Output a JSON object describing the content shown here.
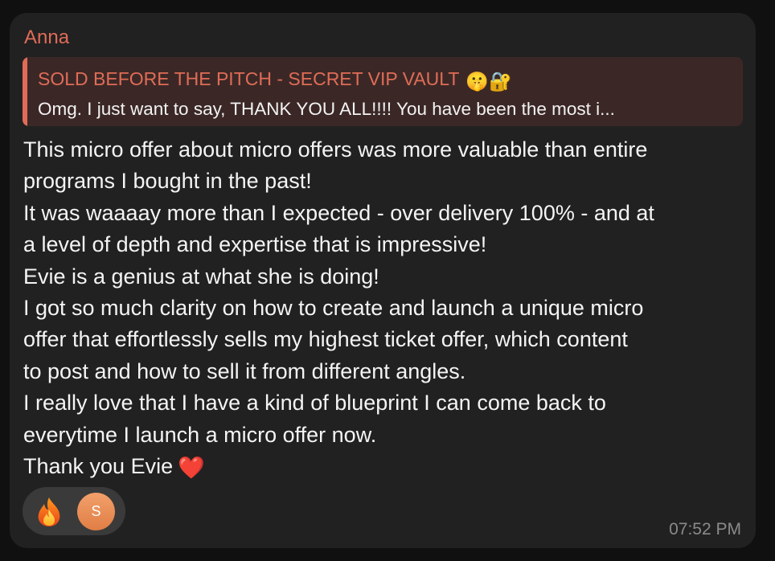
{
  "message": {
    "sender": "Anna",
    "reply": {
      "title": "SOLD BEFORE THE PITCH - SECRET VIP VAULT",
      "title_emoji": "🤫🔐",
      "text": "Omg. I just want to say, THANK YOU ALL!!!! You have been the most i..."
    },
    "body_lines": [
      "This micro offer about micro offers was more valuable than entire",
      "programs I bought in the past!",
      "It was waaaay more than I expected - over delivery 100% - and at",
      "a level of depth and expertise that is impressive!",
      "Evie is a genius at what she is doing!",
      "I got so much clarity on how to create and launch a unique micro",
      "offer that effortlessly sells my highest ticket offer, which content",
      "to post and how to sell it from different angles.",
      "I really love that I have a kind of blueprint I can come back to",
      "everytime I launch a micro offer now.",
      "Thank you Evie"
    ],
    "heart_emoji": "❤️",
    "reactions": {
      "emoji": "fire-icon",
      "reactor_initial": "S"
    },
    "time": "07:52 PM"
  },
  "colors": {
    "accent": "#e06c57",
    "bubble": "#212121",
    "reply_bg": "#3b2826",
    "avatar": "#e8894f"
  }
}
